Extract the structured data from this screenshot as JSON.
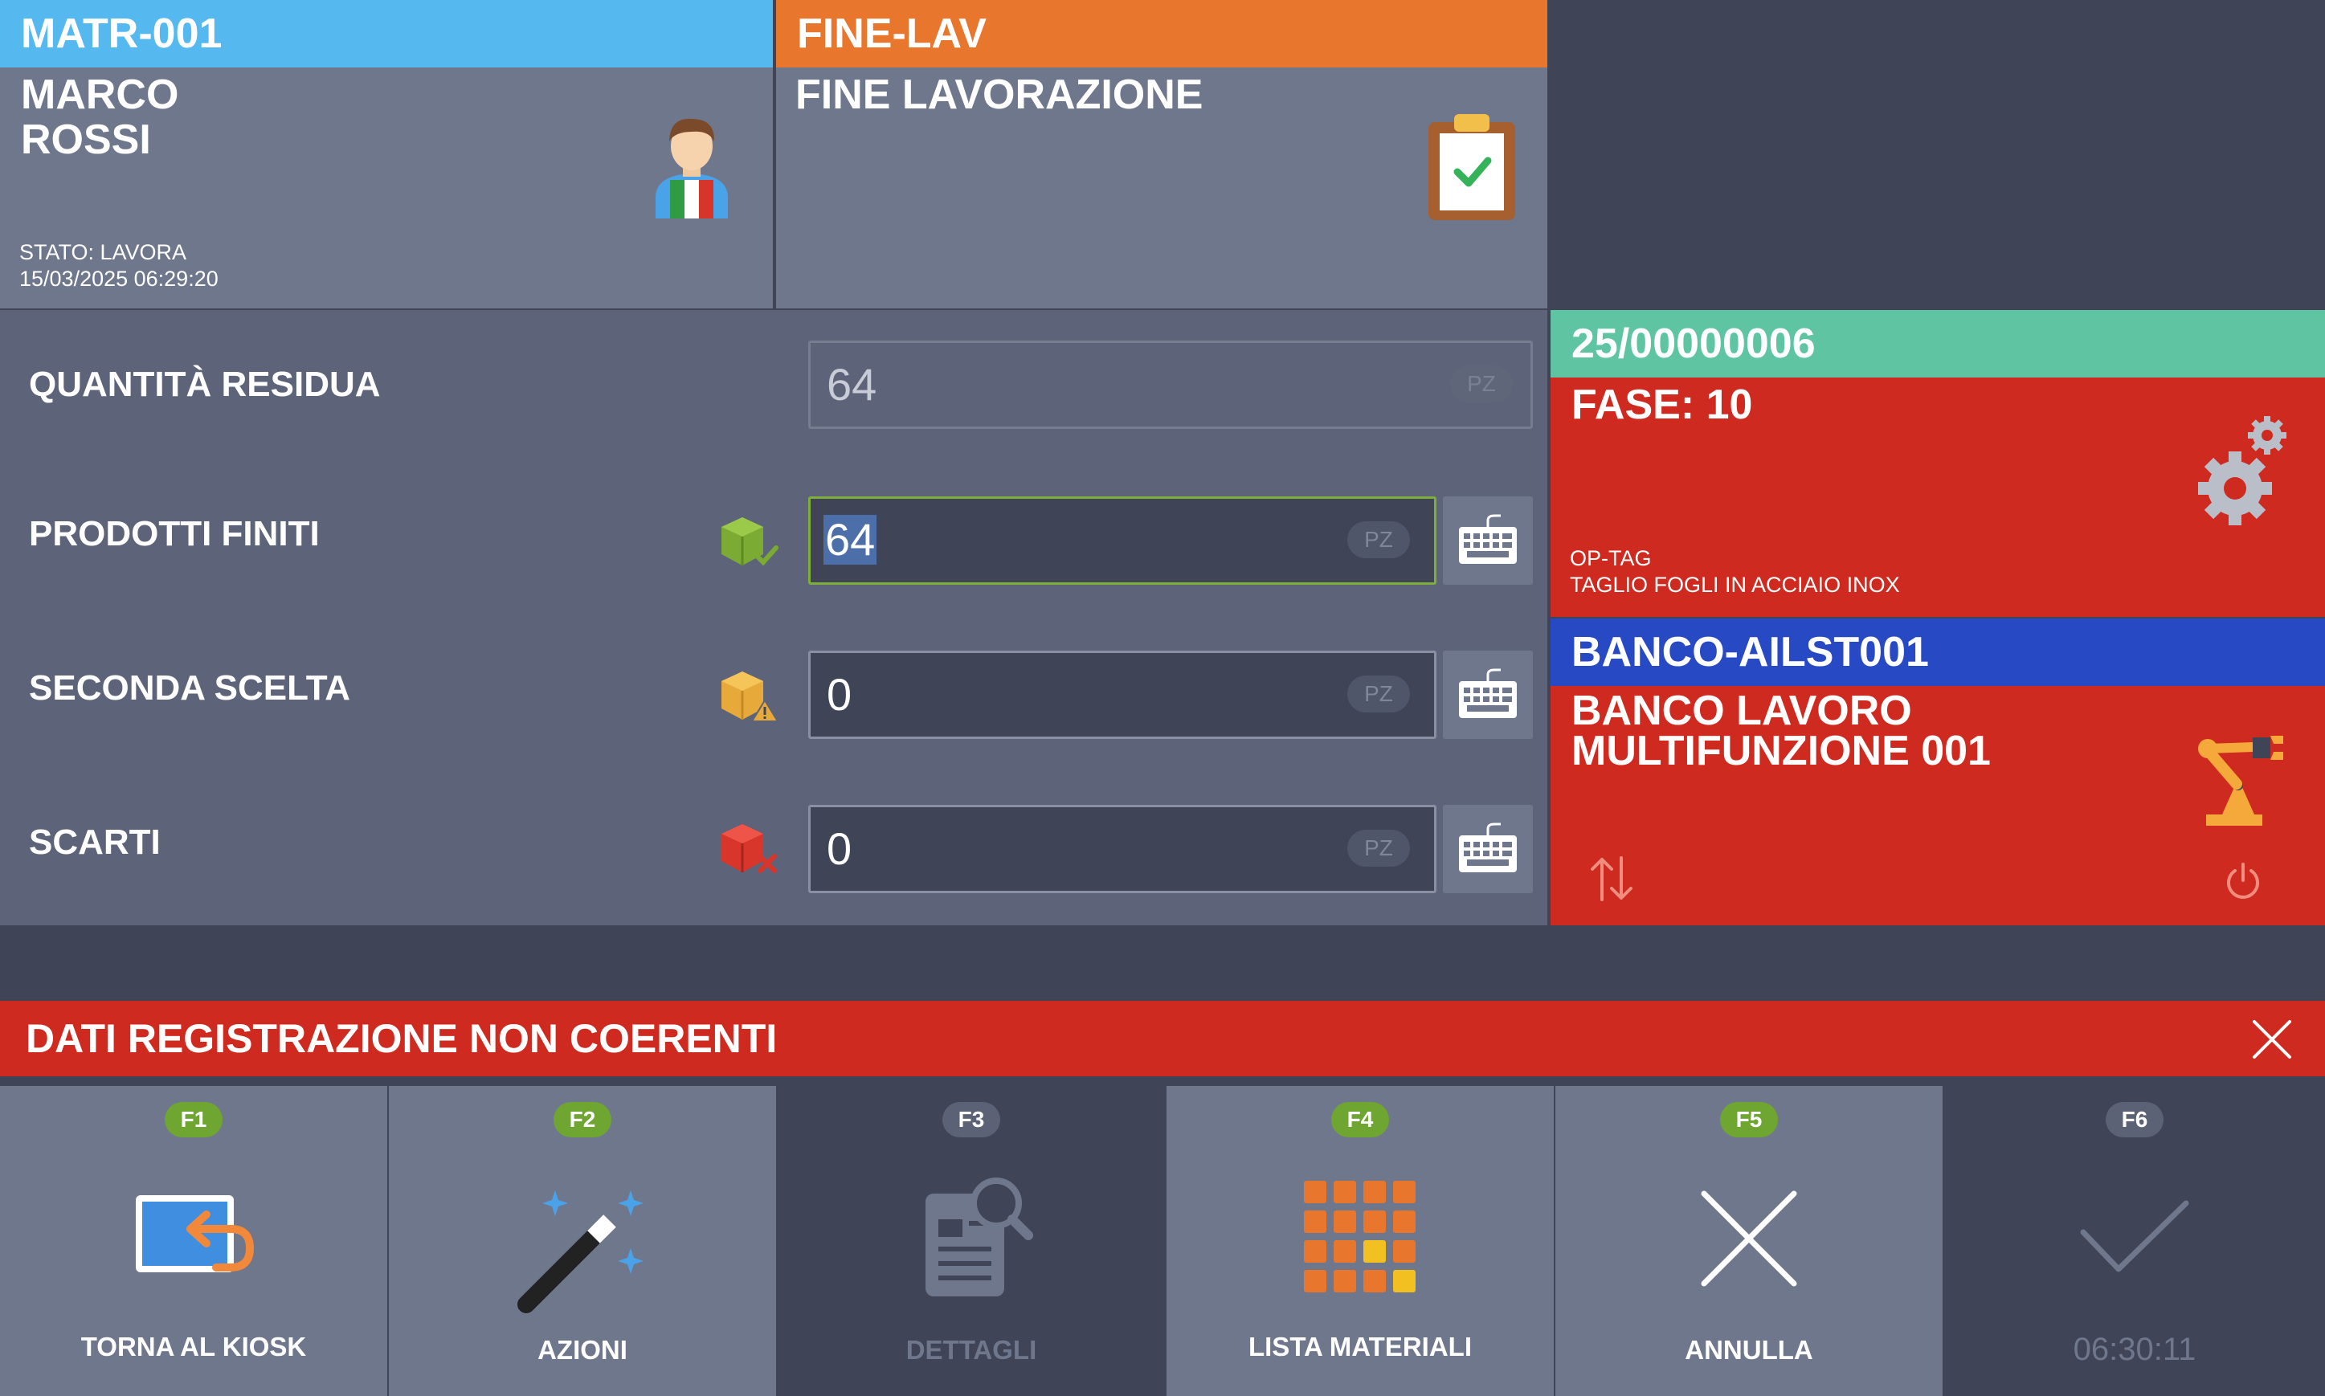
{
  "operator": {
    "code": "MATR-001",
    "first_name": "MARCO",
    "last_name": "ROSSI",
    "status": "STATO: LAVORA",
    "timestamp": "15/03/2025 06:29:20",
    "icon": "operator-avatar-icon"
  },
  "activity": {
    "code": "FINE-LAV",
    "description": "FINE LAVORAZIONE",
    "icon": "clipboard-check-icon"
  },
  "form": {
    "residual": {
      "label": "QUANTITÀ RESIDUA",
      "value": "64",
      "unit": "PZ"
    },
    "finished": {
      "label": "PRODOTTI FINITI",
      "value": "64",
      "unit": "PZ",
      "icon": "box-check-icon"
    },
    "second_choice": {
      "label": "SECONDA SCELTA",
      "value": "0",
      "unit": "PZ",
      "icon": "box-warning-icon"
    },
    "scrap": {
      "label": "SCARTI",
      "value": "0",
      "unit": "PZ",
      "icon": "box-x-icon"
    }
  },
  "order": {
    "number": "25/00000006",
    "phase": "FASE: 10",
    "op_code": "OP-TAG",
    "op_description": "TAGLIO FOGLI IN ACCIAIO INOX",
    "icon": "gears-icon"
  },
  "workstation": {
    "code": "BANCO-AILST001",
    "line1": "BANCO LAVORO",
    "line2": "MULTIFUNZIONE 001",
    "icon": "robot-arm-icon"
  },
  "alert": {
    "message": "DATI REGISTRAZIONE NON COERENTI"
  },
  "function_keys": [
    {
      "key": "F1",
      "label": "TORNA AL KIOSK",
      "icon": "return-to-kiosk-icon"
    },
    {
      "key": "F2",
      "label": "AZIONI",
      "icon": "magic-wand-icon"
    },
    {
      "key": "F3",
      "label": "DETTAGLI",
      "icon": "document-search-icon"
    },
    {
      "key": "F4",
      "label": "LISTA MATERIALI",
      "icon": "grid-materials-icon"
    },
    {
      "key": "F5",
      "label": "ANNULLA",
      "icon": "cancel-x-icon"
    },
    {
      "key": "F6",
      "label": "06:30:11",
      "icon": "confirm-check-icon"
    }
  ],
  "colors": {
    "operator_header": "#55b9f0",
    "activity_header": "#e8762d",
    "order_header": "#5ec4a1",
    "workstation_header": "#2749c4",
    "alert_red": "#cf2a1f",
    "fkey_green": "#6fa531",
    "fkey_gray": "#5b6275"
  }
}
